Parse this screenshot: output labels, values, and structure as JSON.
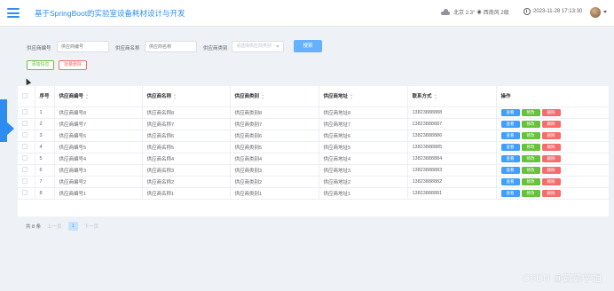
{
  "header": {
    "title": "基于SpringBoot的实验室设备耗材设计与开发",
    "weather": "北京  2.3°  ☀  西南风 2级",
    "datetime": "2023-11-28 17:13:30"
  },
  "search": {
    "fields": [
      {
        "label": "供应商编号",
        "placeholder": "供应商编号"
      },
      {
        "label": "供应商名称",
        "placeholder": "供应商名称"
      },
      {
        "label": "供应商类别",
        "placeholder": "请选择供应商类别"
      }
    ],
    "search_label": "搜索",
    "add_label": "添加信息",
    "batch_delete_label": "批量删除"
  },
  "table": {
    "columns": [
      "序号",
      "供应商编号",
      "供应商名称",
      "供应商类别",
      "供应商地址",
      "联系方式",
      "操作"
    ],
    "rows": [
      {
        "index": "1",
        "code": "供应商编号8",
        "name": "供应商名称8",
        "category": "供应商类别8",
        "address": "供应商地址8",
        "phone": "13823888888"
      },
      {
        "index": "2",
        "code": "供应商编号7",
        "name": "供应商名称7",
        "category": "供应商类别7",
        "address": "供应商地址7",
        "phone": "13823888887"
      },
      {
        "index": "3",
        "code": "供应商编号6",
        "name": "供应商名称6",
        "category": "供应商类别6",
        "address": "供应商地址6",
        "phone": "13823888886"
      },
      {
        "index": "4",
        "code": "供应商编号5",
        "name": "供应商名称5",
        "category": "供应商类别5",
        "address": "供应商地址5",
        "phone": "13823888885"
      },
      {
        "index": "5",
        "code": "供应商编号4",
        "name": "供应商名称4",
        "category": "供应商类别4",
        "address": "供应商地址4",
        "phone": "13823888884"
      },
      {
        "index": "6",
        "code": "供应商编号3",
        "name": "供应商名称3",
        "category": "供应商类别3",
        "address": "供应商地址3",
        "phone": "13823888883"
      },
      {
        "index": "7",
        "code": "供应商编号2",
        "name": "供应商名称2",
        "category": "供应商类别2",
        "address": "供应商地址2",
        "phone": "13823888882"
      },
      {
        "index": "8",
        "code": "供应商编号1",
        "name": "供应商名称1",
        "category": "供应商类别1",
        "address": "供应商地址1",
        "phone": "13823888881"
      }
    ],
    "actions": {
      "view": "查看",
      "edit": "修改",
      "delete": "删除"
    }
  },
  "pagination": {
    "total": "共 8 条",
    "prev": "上一页",
    "current": "1",
    "next": "下一页"
  },
  "watermark": "CSDN @茹茹学姐",
  "colors": {
    "primary": "#409eff",
    "success": "#67c23a",
    "danger": "#f56c6c"
  },
  "icons": [
    "menu-icon",
    "cloud-icon",
    "clock-icon",
    "caret-down-icon",
    "sort-icon",
    "cursor-icon"
  ]
}
